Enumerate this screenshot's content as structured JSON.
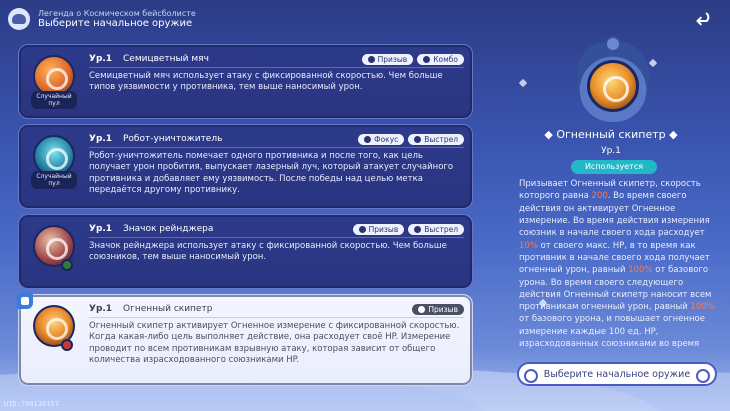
{
  "header": {
    "subtitle": "Легенда о Космическом бейсболисте",
    "title": "Выберите начальное оружие"
  },
  "weapons": [
    {
      "level": "Ур.1",
      "name": "Семицветный мяч",
      "icon": "seven-color-ball-icon",
      "icon_tag": "Случайный пул",
      "tags": [
        "Призыв",
        "Комбо"
      ],
      "description": "Семицветный мяч использует атаку с фиксированной скоростью. Чем больше типов уязвимости у противника, тем выше наносимый урон."
    },
    {
      "level": "Ур.1",
      "name": "Робот-уничтожитель",
      "icon": "robot-destroyer-icon",
      "icon_tag": "Случайный пул",
      "tags": [
        "Фокус",
        "Выстрел"
      ],
      "description": "Робот-уничтожитель помечает одного противника и после того, как цель получает урон пробития, выпускает лазерный луч, который атакует случайного противника и добавляет ему уязвимость. После победы над целью метка передаётся другому противнику."
    },
    {
      "level": "Ур.1",
      "name": "Значок рейнджера",
      "icon": "ranger-badge-icon",
      "icon_tag": "",
      "tags": [
        "Призыв",
        "Выстрел"
      ],
      "description": "Значок рейнджера использует атаку с фиксированной скоростью. Чем больше союзников, тем выше наносимый урон."
    },
    {
      "level": "Ур.1",
      "name": "Огненный скипетр",
      "icon": "fire-scepter-icon",
      "icon_tag": "",
      "tags": [
        "Призыв"
      ],
      "selected": true,
      "description": "Огненный скипетр активирует Огненное измерение с фиксированной скоростью. Когда какая-либо цель выполняет действие, она расходует своё HP. Измерение проводит по всем противникам взрывную атаку, которая зависит от общего количества израсходованного союзниками HP."
    }
  ],
  "detail": {
    "name": "Огненный скипетр",
    "level": "Ур.1",
    "status": "Используется",
    "desc_1": "Призывает Огненный скипетр, скорость которого равна ",
    "speed": "200",
    "desc_2": ". Во время своего действия он активирует Огненное измерение. Во время действия измерения союзник в начале своего хода расходует ",
    "hp_pct": "10%",
    "desc_3": " от своего макс. HP, в то время как противник в начале своего хода получает огненный урон, равный ",
    "dmg_pct": "100%",
    "desc_4": " от базового урона. Во время своего следующего действия Огненный скипетр наносит всем противникам огненный урон, равный ",
    "burst_pct": "100%",
    "desc_5": " от базового урона, и повышает огненное измерение каждые 100 ед. HP, израсходованных союзниками во время"
  },
  "choose_button": "Выберите начальное оружие",
  "uid": "UID:700130157"
}
